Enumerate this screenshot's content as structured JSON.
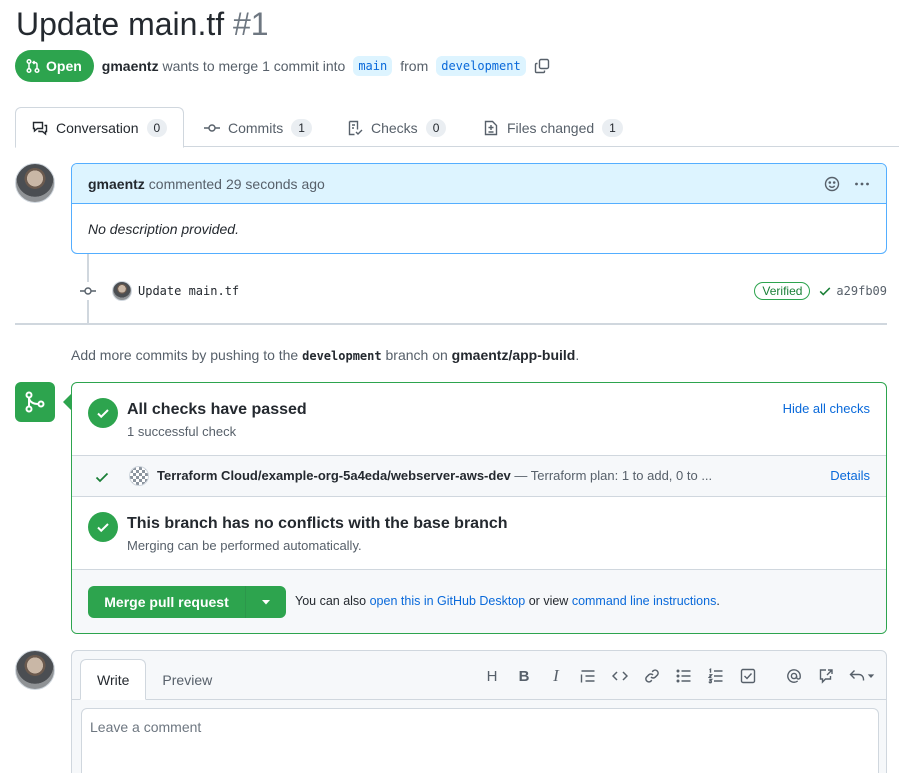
{
  "pr": {
    "title": "Update main.tf",
    "number": "#1",
    "state": "Open",
    "author": "gmaentz",
    "merge_text": "wants to merge 1 commit into",
    "base_branch": "main",
    "from_text": "from",
    "head_branch": "development"
  },
  "tabs": [
    {
      "label": "Conversation",
      "count": "0"
    },
    {
      "label": "Commits",
      "count": "1"
    },
    {
      "label": "Checks",
      "count": "0"
    },
    {
      "label": "Files changed",
      "count": "1"
    }
  ],
  "comment": {
    "author": "gmaentz",
    "action": "commented",
    "time": "29 seconds ago",
    "body": "No description provided."
  },
  "commit": {
    "message": "Update main.tf",
    "badge": "Verified",
    "sha": "a29fb09"
  },
  "push_hint": {
    "prefix": "Add more commits by pushing to the",
    "branch": "development",
    "middle": "branch on",
    "repo": "gmaentz/app-build",
    "suffix": "."
  },
  "checks": {
    "title": "All checks have passed",
    "subtitle": "1 successful check",
    "toggle_label": "Hide all checks",
    "item_name": "Terraform Cloud/example-org-5a4eda/webserver-aws-dev",
    "item_desc": "— Terraform plan: 1 to add, 0 to ...",
    "item_link": "Details"
  },
  "conflicts": {
    "title": "This branch has no conflicts with the base branch",
    "subtitle": "Merging can be performed automatically."
  },
  "merge": {
    "button_label": "Merge pull request",
    "hint_prefix": "You can also",
    "desktop_link": "open this in GitHub Desktop",
    "hint_middle": "or view",
    "cli_link": "command line instructions",
    "hint_suffix": "."
  },
  "editor": {
    "tab_write": "Write",
    "tab_preview": "Preview",
    "placeholder": "Leave a comment",
    "toolbar": {
      "heading": "H",
      "bold": "B",
      "italic": "I"
    }
  },
  "colors": {
    "success": "#2da44e",
    "link": "#0969da",
    "comment_header": "#ddf4ff"
  }
}
